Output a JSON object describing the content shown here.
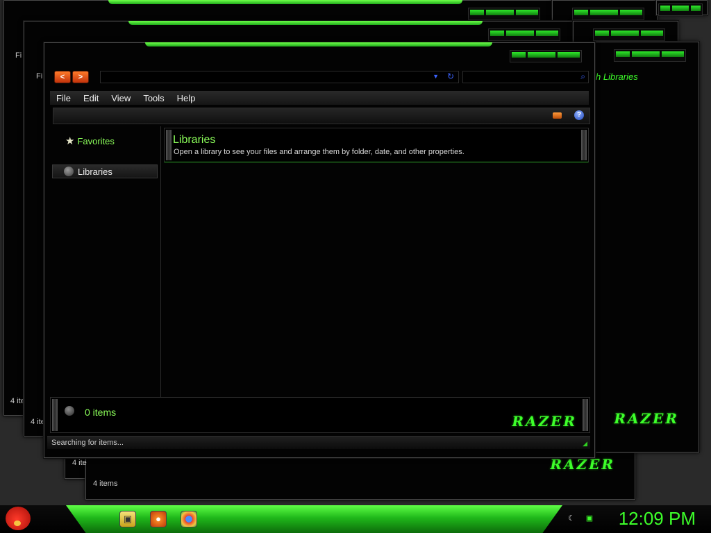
{
  "background_windows": {
    "menu_fragment": "Fi",
    "item_count_fragment": "4 ite",
    "item_count_full": "4 items",
    "search_fragment": "h Libraries",
    "brand": "RAZER"
  },
  "main_window": {
    "nav": {
      "back_glyph": "<",
      "forward_glyph": ">"
    },
    "address": {
      "value": "",
      "placeholder": ""
    },
    "search": {
      "value": "",
      "placeholder": ""
    },
    "menu": {
      "file": "File",
      "edit": "Edit",
      "view": "View",
      "tools": "Tools",
      "help": "Help"
    },
    "toolbar": {
      "help_glyph": "?"
    },
    "navpane": {
      "favorites": "Favorites",
      "libraries": "Libraries"
    },
    "banner": {
      "title": "Libraries",
      "description": "Open a library to see your files and arrange them by folder, date, and other properties."
    },
    "details": {
      "count": "0 items",
      "brand": "RAZER"
    },
    "status": {
      "text": "Searching for items..."
    }
  },
  "taskbar": {
    "clock": "12:09 PM",
    "icons": [
      "start-orb-icon",
      "folder-icon",
      "firefox-icon",
      "chrome-icon"
    ],
    "tray": [
      "moon-icon",
      "monitor-icon"
    ]
  },
  "colors": {
    "accent_green": "#3dff2a",
    "label_green": "#8cff5a",
    "nav_orange": "#ff7b2a",
    "icon_blue": "#3b63ff"
  }
}
